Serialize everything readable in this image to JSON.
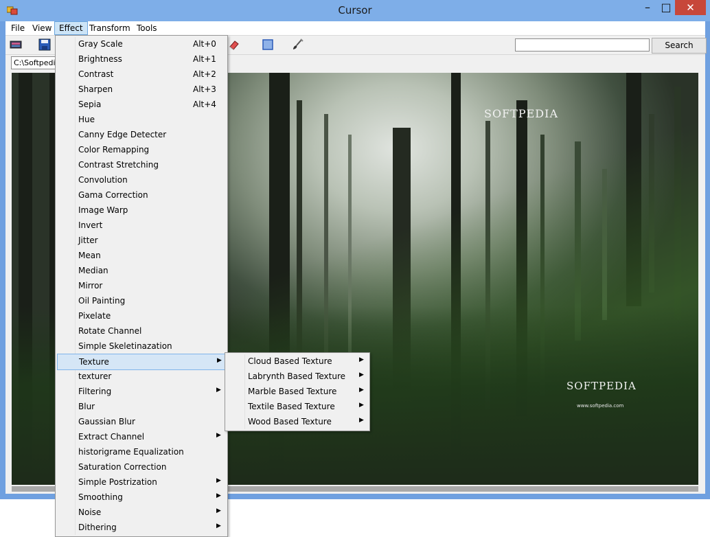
{
  "window": {
    "title": "Cursor"
  },
  "titlebar": {
    "minimize": "–",
    "maximize": "□",
    "close": "✕"
  },
  "menubar": {
    "items": [
      "File",
      "View",
      "Effect",
      "Transform",
      "Tools"
    ],
    "active": "Effect"
  },
  "toolbar": {
    "icons": [
      "image-icon",
      "save-icon",
      "eraser-icon",
      "select-rect-icon",
      "brush-icon"
    ],
    "search_value": "",
    "search_label": "Search"
  },
  "path": {
    "value": "C:\\Softpedia"
  },
  "canvas": {
    "watermark_top": "SOFTPEDIA",
    "watermark_logo": "SOFTPEDIA",
    "watermark_url": "www.softpedia.com"
  },
  "effect_menu": {
    "items": [
      {
        "label": "Gray Scale",
        "shortcut": "Alt+0"
      },
      {
        "label": "Brightness",
        "shortcut": "Alt+1"
      },
      {
        "label": "Contrast",
        "shortcut": "Alt+2"
      },
      {
        "label": "Sharpen",
        "shortcut": "Alt+3"
      },
      {
        "label": "Sepia",
        "shortcut": "Alt+4"
      },
      {
        "label": "Hue"
      },
      {
        "label": "Canny Edge Detecter"
      },
      {
        "label": "Color Remapping"
      },
      {
        "label": "Contrast Stretching"
      },
      {
        "label": "Convolution"
      },
      {
        "label": "Gama Correction"
      },
      {
        "label": "Image Warp"
      },
      {
        "label": "Invert"
      },
      {
        "label": "Jitter"
      },
      {
        "label": "Mean"
      },
      {
        "label": "Median"
      },
      {
        "label": "Mirror"
      },
      {
        "label": "Oil Painting"
      },
      {
        "label": "Pixelate"
      },
      {
        "label": "Rotate Channel"
      },
      {
        "label": "Simple Skeletinazation"
      },
      {
        "label": "Texture",
        "submenu": true,
        "highlighted": true
      },
      {
        "label": "texturer"
      },
      {
        "label": "Filtering",
        "submenu": true
      },
      {
        "label": "Blur"
      },
      {
        "label": "Gaussian Blur"
      },
      {
        "label": "Extract Channel",
        "submenu": true
      },
      {
        "label": "historigrame Equalization"
      },
      {
        "label": "Saturation Correction"
      },
      {
        "label": "Simple Postrization",
        "submenu": true
      },
      {
        "label": "Smoothing",
        "submenu": true
      },
      {
        "label": "Noise",
        "submenu": true
      },
      {
        "label": "Dithering",
        "submenu": true
      }
    ]
  },
  "texture_submenu": {
    "items": [
      {
        "label": "Cloud Based Texture",
        "submenu": true
      },
      {
        "label": "Labrynth Based Texture",
        "submenu": true
      },
      {
        "label": "Marble Based Texture",
        "submenu": true
      },
      {
        "label": "Textile Based Texture",
        "submenu": true
      },
      {
        "label": "Wood Based Texture",
        "submenu": true
      }
    ]
  }
}
